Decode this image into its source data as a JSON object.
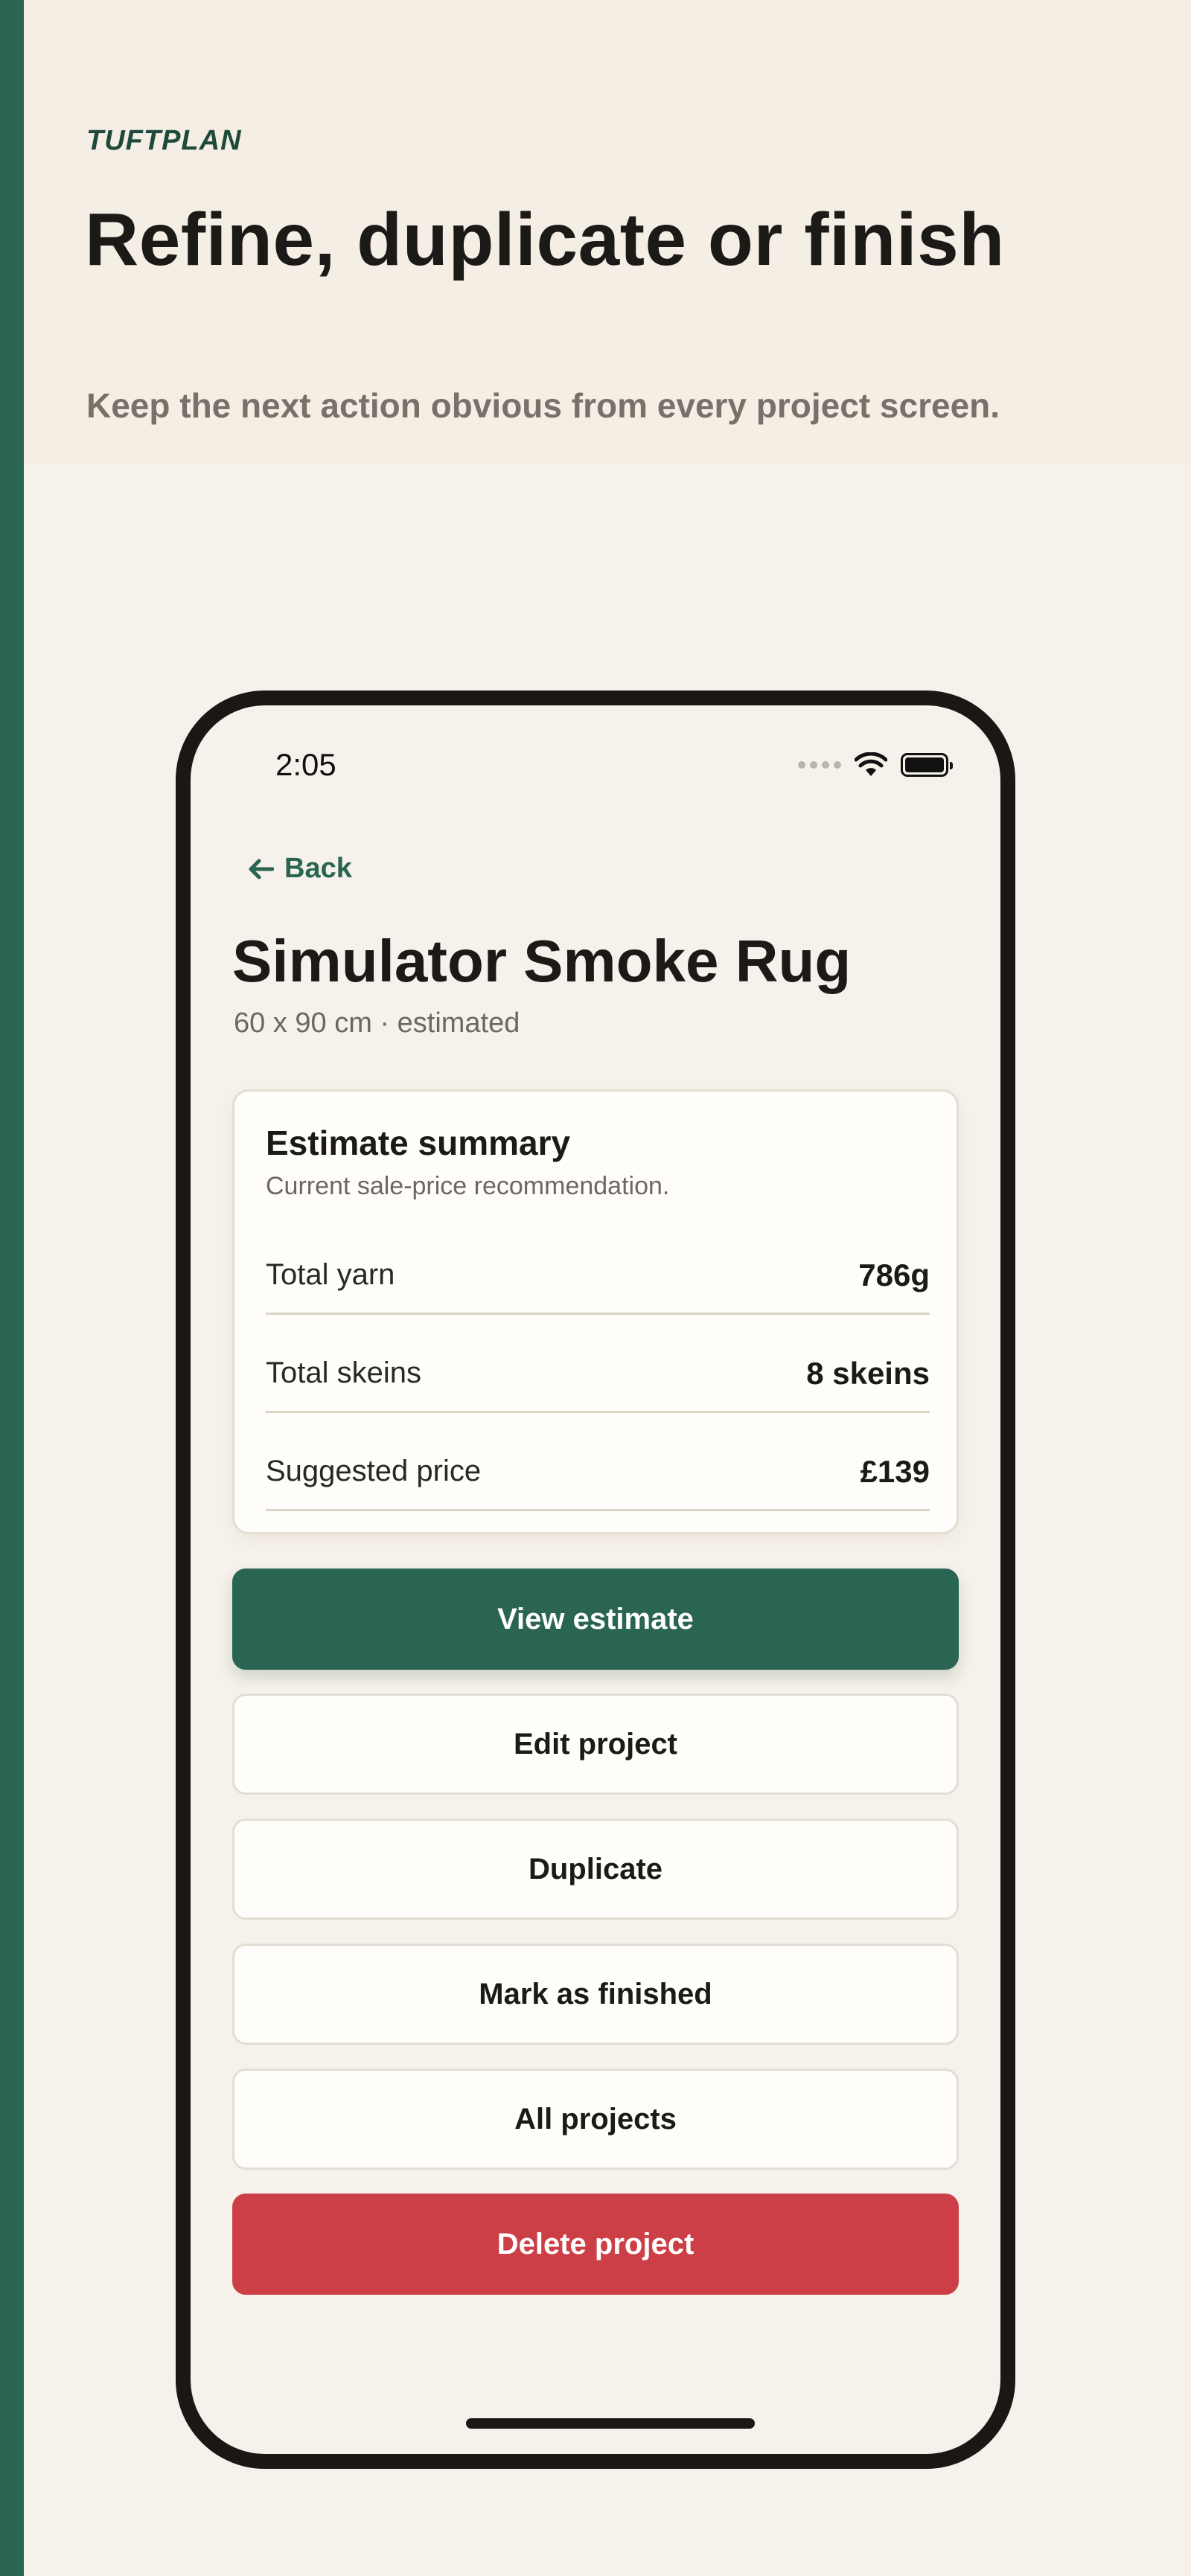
{
  "header": {
    "brand": "TUFTPLAN",
    "headline": "Refine, duplicate or finish",
    "subline": "Keep the next action obvious from every project screen."
  },
  "status_bar": {
    "time": "2:05"
  },
  "project": {
    "back_label": "Back",
    "title": "Simulator Smoke Rug",
    "meta": "60 x 90 cm · estimated"
  },
  "summary": {
    "title": "Estimate summary",
    "subtitle": "Current sale-price recommendation.",
    "rows": [
      {
        "label": "Total yarn",
        "value": "786g"
      },
      {
        "label": "Total skeins",
        "value": "8 skeins"
      },
      {
        "label": "Suggested price",
        "value": "£139"
      }
    ]
  },
  "actions": {
    "view_estimate": "View estimate",
    "edit_project": "Edit project",
    "duplicate": "Duplicate",
    "mark_finished": "Mark as finished",
    "all_projects": "All projects",
    "delete_project": "Delete project"
  },
  "colors": {
    "accent": "#2a6452",
    "danger": "#cc3f47",
    "background": "#f6f1eb"
  }
}
